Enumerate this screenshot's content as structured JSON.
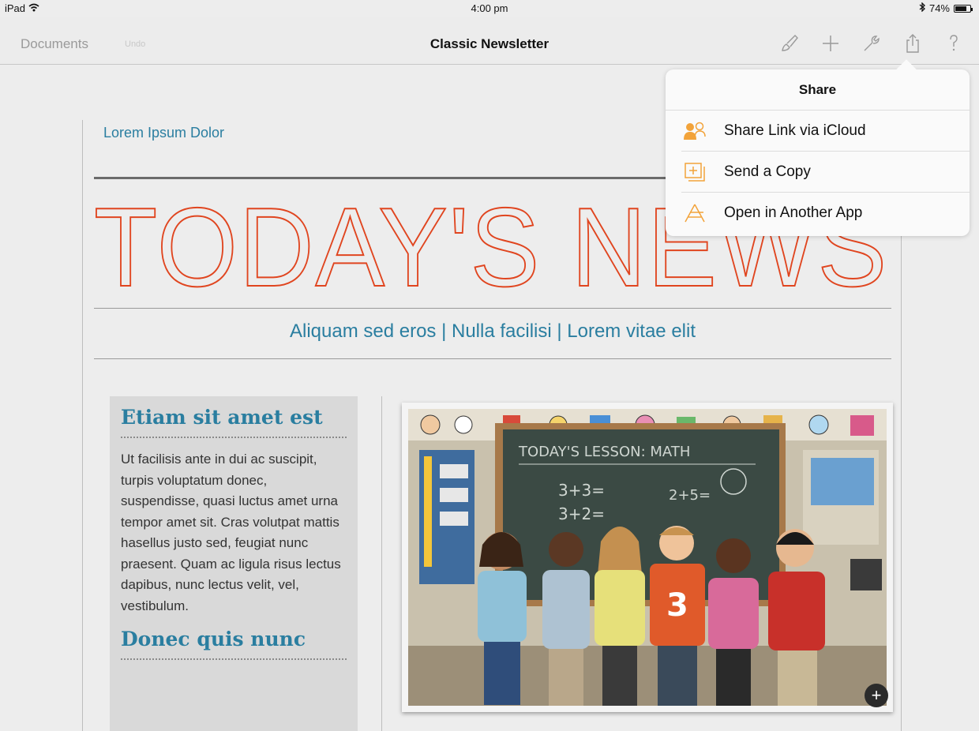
{
  "status_bar": {
    "device": "iPad",
    "time": "4:00 pm",
    "battery": "74%"
  },
  "nav": {
    "back_label": "Documents",
    "undo_label": "Undo",
    "title": "Classic Newsletter",
    "tools": [
      "format-brush-icon",
      "plus-icon",
      "wrench-icon",
      "share-icon",
      "help-icon"
    ]
  },
  "document": {
    "kicker": "Lorem Ipsum Dolor",
    "headline": "TODAY'S NEWS",
    "subnav": "Aliquam sed eros | Nulla facilisi | Lorem vitae elit",
    "sidebar": {
      "heading1": "Etiam sit amet est",
      "body1": "Ut facilisis ante in dui ac suscipit, turpis voluptatum donec, suspendisse, quasi luctus amet urna tempor amet sit. Cras volutpat mattis hasellus justo sed, feugiat nunc praesent. Quam ac ligula risus lectus dapibus, nunc lectus velit, vel, vestibulum.",
      "heading2": "Donec quis nunc"
    },
    "photo": {
      "chalkboard_text": "TODAY'S LESSON: MATH",
      "jersey_number": "3",
      "add_label": "+"
    }
  },
  "share_popover": {
    "title": "Share",
    "items": [
      {
        "label": "Share Link via iCloud",
        "icon": "people-icon"
      },
      {
        "label": "Send a Copy",
        "icon": "send-copy-icon"
      },
      {
        "label": "Open in Another App",
        "icon": "app-store-icon"
      }
    ]
  },
  "colors": {
    "accent_blue": "#2a7ea0",
    "headline_red": "#e0451f",
    "icon_orange": "#f2a33a"
  }
}
